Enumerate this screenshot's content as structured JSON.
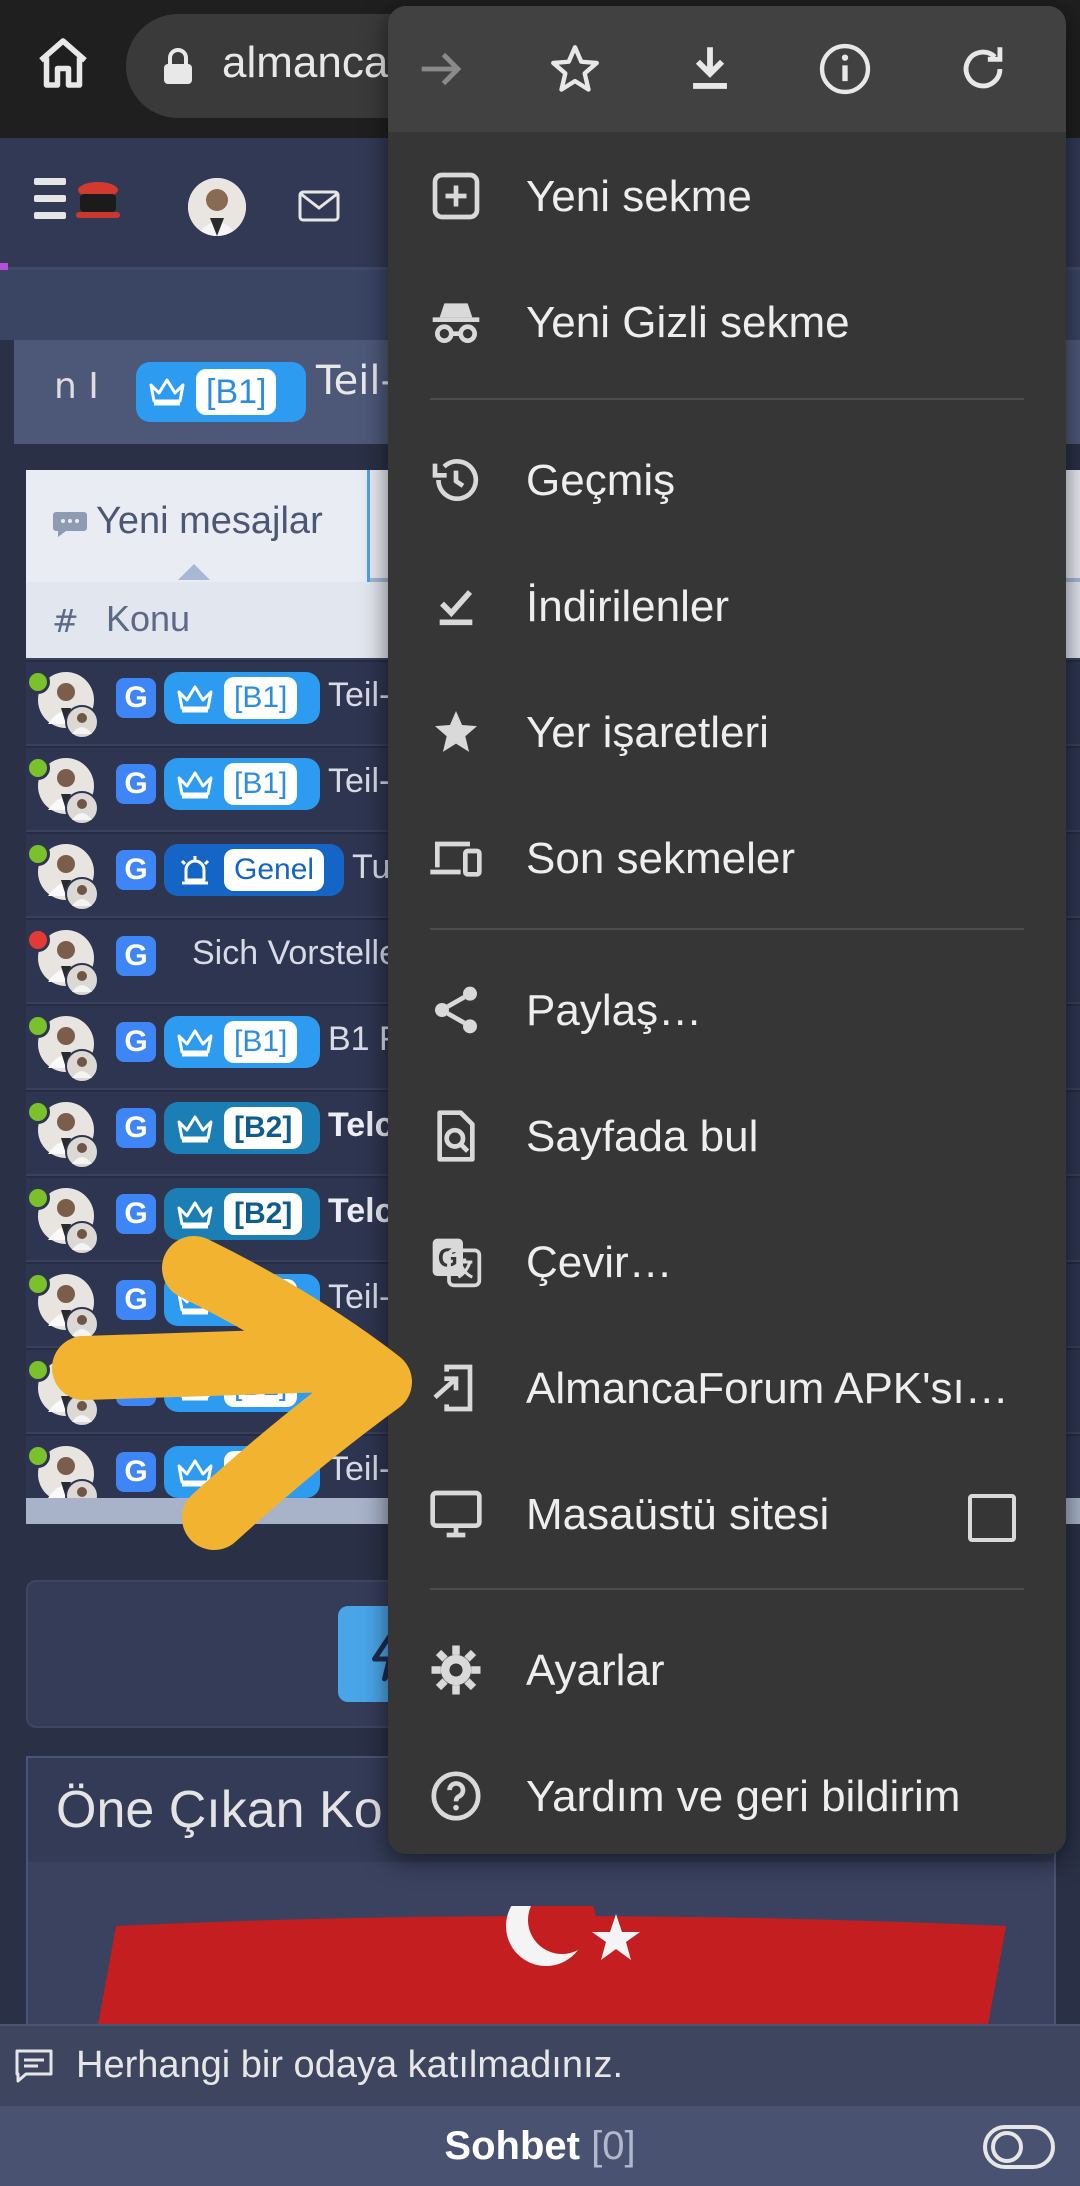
{
  "browser": {
    "url_text": "almanca"
  },
  "thread_title": {
    "left_text": "n  I",
    "prefix": "[B1]",
    "text": "Teil-"
  },
  "feed": {
    "tab_label": "Yeni mesajlar",
    "column_hash": "#",
    "column_topic": "Konu",
    "rows": [
      {
        "status": "online",
        "status_color": "#7bc12c",
        "prefix": "[B1]",
        "prefix_style": "b1",
        "title": "Teil-",
        "bold": false
      },
      {
        "status": "online",
        "status_color": "#7bc12c",
        "prefix": "[B1]",
        "prefix_style": "b1",
        "title": "Teil-",
        "bold": false
      },
      {
        "status": "online",
        "status_color": "#7bc12c",
        "prefix": "Genel",
        "prefix_style": "genel",
        "title": "Tu",
        "bold": false
      },
      {
        "status": "busy",
        "status_color": "#e53935",
        "prefix": "",
        "prefix_style": "none",
        "title": "Sich Vorsteller",
        "bold": false
      },
      {
        "status": "online",
        "status_color": "#7bc12c",
        "prefix": "[B1]",
        "prefix_style": "b1",
        "title": "B1 F",
        "bold": false
      },
      {
        "status": "online",
        "status_color": "#7bc12c",
        "prefix": "[B2]",
        "prefix_style": "b2",
        "title": "Telc",
        "bold": true
      },
      {
        "status": "online",
        "status_color": "#7bc12c",
        "prefix": "[B2]",
        "prefix_style": "b2",
        "title": "Telc",
        "bold": true
      },
      {
        "status": "online",
        "status_color": "#7bc12c",
        "prefix": "[B1]",
        "prefix_style": "b1",
        "title": "Teil-",
        "bold": false
      },
      {
        "status": "online",
        "status_color": "#7bc12c",
        "prefix": "[B1]",
        "prefix_style": "b1",
        "title": "",
        "bold": false
      },
      {
        "status": "online",
        "status_color": "#7bc12c",
        "prefix": "[B1]",
        "prefix_style": "b1",
        "title": "Teil-",
        "bold": false
      }
    ]
  },
  "featured": {
    "title": "Öne Çıkan Ko"
  },
  "chat": {
    "status_text": "Herhangi bir odaya katılmadınız.",
    "title": "Sohbet",
    "count": "[0]"
  },
  "menu": {
    "toolbar": [
      "forward-icon",
      "bookmark-star-icon",
      "download-icon",
      "info-icon",
      "reload-icon"
    ],
    "items": [
      {
        "label": "Yeni sekme",
        "icon": "new-tab-icon"
      },
      {
        "label": "Yeni Gizli sekme",
        "icon": "incognito-icon"
      },
      {
        "label": "Geçmiş",
        "icon": "history-icon"
      },
      {
        "label": "İndirilenler",
        "icon": "downloads-icon"
      },
      {
        "label": "Yer işaretleri",
        "icon": "bookmarks-star-icon"
      },
      {
        "label": "Son sekmeler",
        "icon": "recent-tabs-icon"
      },
      {
        "label": "Paylaş…",
        "icon": "share-icon"
      },
      {
        "label": "Sayfada bul",
        "icon": "find-in-page-icon"
      },
      {
        "label": "Çevir…",
        "icon": "translate-icon"
      },
      {
        "label": "AlmancaForum APK'sı…",
        "icon": "install-app-icon"
      },
      {
        "label": "Masaüstü sitesi",
        "icon": "desktop-icon",
        "checked": false
      },
      {
        "label": "Ayarlar",
        "icon": "settings-gear-icon"
      },
      {
        "label": "Yardım ve geri bildirim",
        "icon": "help-icon"
      }
    ]
  },
  "colors": {
    "menu_bg": "#363636",
    "accent_blue": "#2d9bf0",
    "annotation_arrow": "#f2b430"
  }
}
